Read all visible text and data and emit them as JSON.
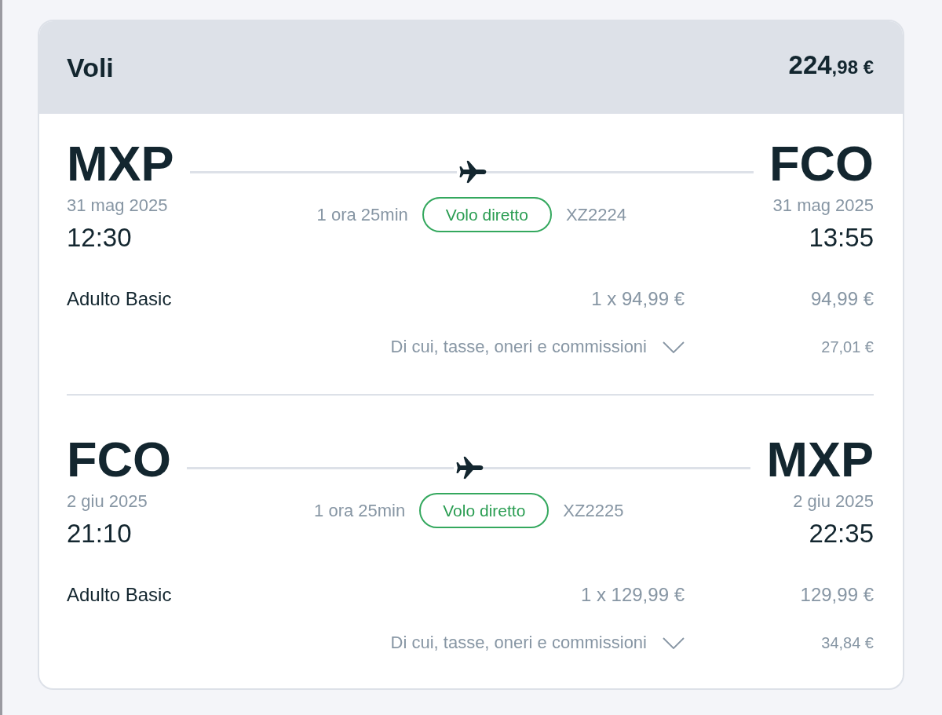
{
  "section": {
    "title": "Voli",
    "total": {
      "integer": "224",
      "decimals": ",98 €"
    }
  },
  "flights": [
    {
      "origin": {
        "code": "MXP",
        "date": "31 mag 2025",
        "time": "12:30"
      },
      "destination": {
        "code": "FCO",
        "date": "31 mag 2025",
        "time": "13:55"
      },
      "duration": "1 ora 25min",
      "badge": "Volo diretto",
      "flight_number": "XZ2224",
      "fares": [
        {
          "label": "Adulto Basic",
          "unit_price": "1 x 94,99 €",
          "total": "94,99 €"
        }
      ],
      "taxes": {
        "label": "Di cui, tasse, oneri e commissioni",
        "amount": "27,01 €",
        "expanded": false
      }
    },
    {
      "origin": {
        "code": "FCO",
        "date": "2 giu 2025",
        "time": "21:10"
      },
      "destination": {
        "code": "MXP",
        "date": "2 giu 2025",
        "time": "22:35"
      },
      "duration": "1 ora 25min",
      "badge": "Volo diretto",
      "flight_number": "XZ2225",
      "fares": [
        {
          "label": "Adulto Basic",
          "unit_price": "1 x 129,99 €",
          "total": "129,99 €"
        }
      ],
      "taxes": {
        "label": "Di cui, tasse, oneri e commissioni",
        "amount": "34,84 €",
        "expanded": false
      }
    }
  ]
}
